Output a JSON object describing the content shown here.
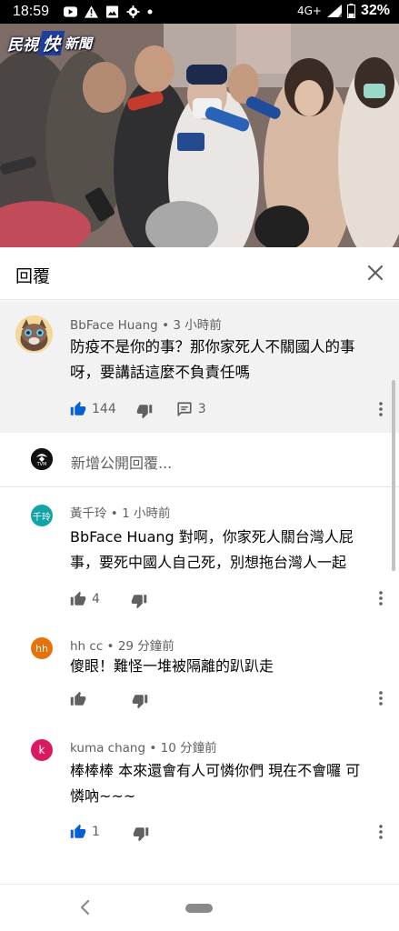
{
  "status_bar": {
    "time": "18:59",
    "network": "4G+",
    "battery_percent": "32%",
    "battery_level": 0.32
  },
  "video": {
    "logo_part1": "民視",
    "logo_part2": "快",
    "logo_part3": "新聞"
  },
  "reply_panel": {
    "title": "回覆",
    "close_icon": "close-icon"
  },
  "parent_comment": {
    "author": "BbFace Huang",
    "time": "3 小時前",
    "text_line1": "防疫不是你的事？那你家死人不關國人的事",
    "text_line2": "呀，要講話這麼不負責任嗎",
    "likes": "144",
    "replies": "3"
  },
  "add_reply": {
    "placeholder": "新增公開回覆...",
    "avatar_label": "TVM"
  },
  "replies": [
    {
      "author": "黃千玲",
      "time": "1 小時前",
      "avatar_label": "千玲",
      "avatar_color": "#12a3a8",
      "text_line1": "BbFace Huang 對啊，你家死人關台灣人屁",
      "text_line2": "事，要死中國人自己死，別想拖台灣人一起",
      "likes": "4"
    },
    {
      "author": "hh cc",
      "time": "29 分鐘前",
      "avatar_label": "hh",
      "avatar_color": "#e8710a",
      "text_line1": "傻眼！難怪一堆被隔離的趴趴走",
      "text_line2": "",
      "likes": ""
    },
    {
      "author": "kuma chang",
      "time": "10 分鐘前",
      "avatar_label": "k",
      "avatar_color": "#d81b60",
      "text_line1": "棒棒棒 本來還會有人可憐你們 現在不會囉 可",
      "text_line2": "憐吶~~~",
      "likes": "1"
    }
  ],
  "colors": {
    "like_active": "#065fd4",
    "icon_gray": "#606060"
  }
}
